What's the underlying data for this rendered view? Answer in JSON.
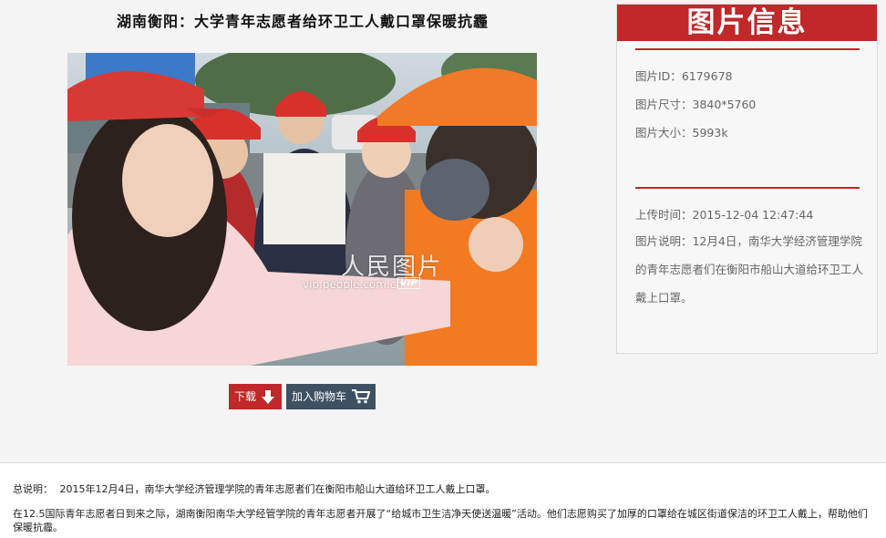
{
  "page": {
    "title": "湖南衡阳：大学青年志愿者给环卫工人戴口罩保暖抗霾"
  },
  "photo": {
    "watermark_main": "人民图片",
    "watermark_sub": "vip.people.com.cn",
    "watermark_badge": "VIP"
  },
  "actions": {
    "download_label": "下载",
    "cart_label": "加入购物车"
  },
  "info_panel": {
    "heading": "图片信息",
    "id_label": "图片ID：",
    "id_value": "6179678",
    "size_label": "图片尺寸：",
    "size_value": "3840*5760",
    "filesize_label": "图片大小：",
    "filesize_value": "5993k",
    "upload_label": "上传时间：",
    "upload_value": "2015-12-04 12:47:44",
    "desc_label": "图片说明：",
    "desc_value": "12月4日，南华大学经济管理学院的青年志愿者们在衡阳市船山大道给环卫工人戴上口罩。"
  },
  "summary": {
    "label": "总说明：",
    "text": "2015年12月4日，南华大学经济管理学院的青年志愿者们在衡阳市船山大道给环卫工人戴上口罩。",
    "body": "在12.5国际青年志愿者日到来之际，湖南衡阳南华大学经管学院的青年志愿者开展了“给城市卫生洁净天使送温暖”活动。他们志愿购买了加厚的口罩给在城区街道保洁的环卫工人戴上，帮助他们保暖抗霾。"
  },
  "colors": {
    "accent": "#c0282a",
    "cart_button": "#3d5163",
    "page_background": "#f4f4f4"
  }
}
